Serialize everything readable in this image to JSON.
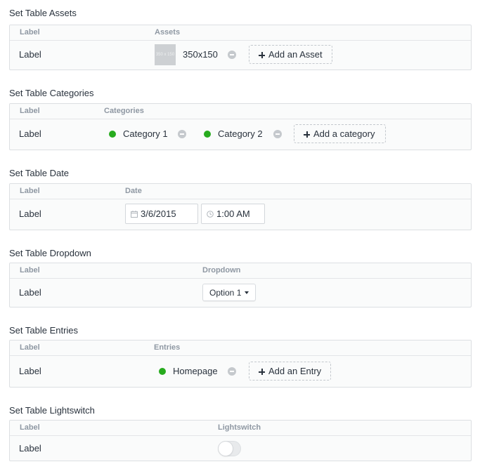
{
  "assets": {
    "title": "Set Table Assets",
    "col_label": "Label",
    "col_value": "Assets",
    "row_label": "Label",
    "thumb_text": "350 x 150",
    "asset_name": "350x150",
    "add_label": "Add an Asset"
  },
  "categories": {
    "title": "Set Table Categories",
    "col_label": "Label",
    "col_value": "Categories",
    "row_label": "Label",
    "items": [
      "Category 1",
      "Category 2"
    ],
    "add_label": "Add a category",
    "status_color": "#27ab1e"
  },
  "date": {
    "title": "Set Table Date",
    "col_label": "Label",
    "col_value": "Date",
    "row_label": "Label",
    "date_value": "3/6/2015",
    "time_value": "1:00 AM"
  },
  "dropdown": {
    "title": "Set Table Dropdown",
    "col_label": "Label",
    "col_value": "Dropdown",
    "row_label": "Label",
    "selected": "Option 1"
  },
  "entries": {
    "title": "Set Table Entries",
    "col_label": "Label",
    "col_value": "Entries",
    "row_label": "Label",
    "items": [
      "Homepage"
    ],
    "add_label": "Add an Entry",
    "status_color": "#27ab1e"
  },
  "lightswitch": {
    "title": "Set Table Lightswitch",
    "col_label": "Label",
    "col_value": "Lightswitch",
    "row_label": "Label",
    "state": "off"
  },
  "icons": {
    "calendar": "calendar-icon",
    "clock": "clock-icon",
    "plus": "plus-icon",
    "remove": "remove-icon",
    "caret": "caret-down-icon"
  }
}
